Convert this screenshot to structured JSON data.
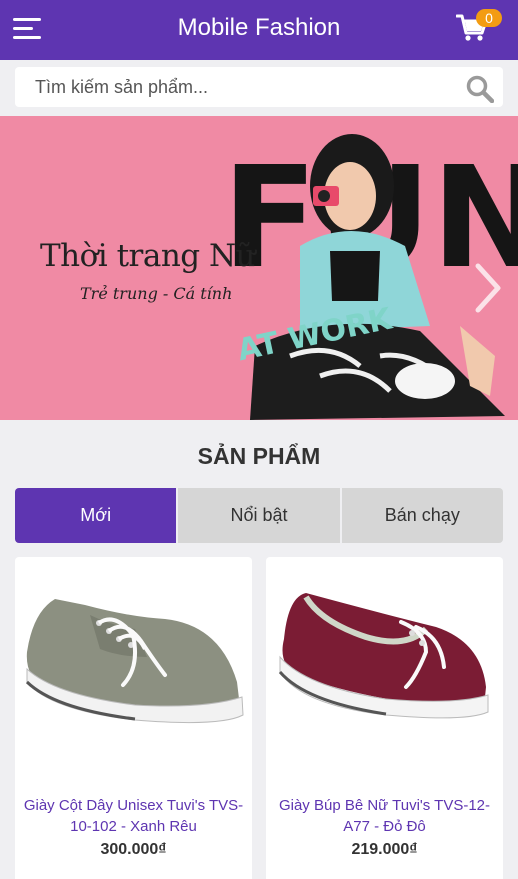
{
  "header": {
    "title": "Mobile Fashion",
    "menu_icon": "hamburger-menu-icon",
    "cart_icon": "shopping-cart-icon",
    "cart_count": "0",
    "color": "#5e35b1",
    "badge_color": "#f39c12"
  },
  "search": {
    "placeholder": "Tìm kiếm sản phẩm...",
    "value": "",
    "icon": "search-icon"
  },
  "banner": {
    "title": "Thời trang Nữ",
    "subtitle": "Trẻ trung - Cá tính",
    "graphic_text": "FUN",
    "graphic_subtext": "AT WORK",
    "next_icon": "chevron-right-icon",
    "background_color": "#f08aa4"
  },
  "products_section": {
    "title": "SẢN PHẨM",
    "tabs": [
      {
        "label": "Mới",
        "active": true
      },
      {
        "label": "Nổi bật",
        "active": false
      },
      {
        "label": "Bán chạy",
        "active": false
      }
    ],
    "items": [
      {
        "name": "Giày Cột Dây Unisex Tuvi's TVS-10-102 - Xanh Rêu",
        "price": "300.000₫",
        "image": "gray-canvas-sneaker"
      },
      {
        "name": "Giày Búp Bê Nữ Tuvi's TVS-12-A77 - Đỏ Đô",
        "price": "219.000₫",
        "image": "maroon-canvas-slip-on"
      }
    ]
  }
}
